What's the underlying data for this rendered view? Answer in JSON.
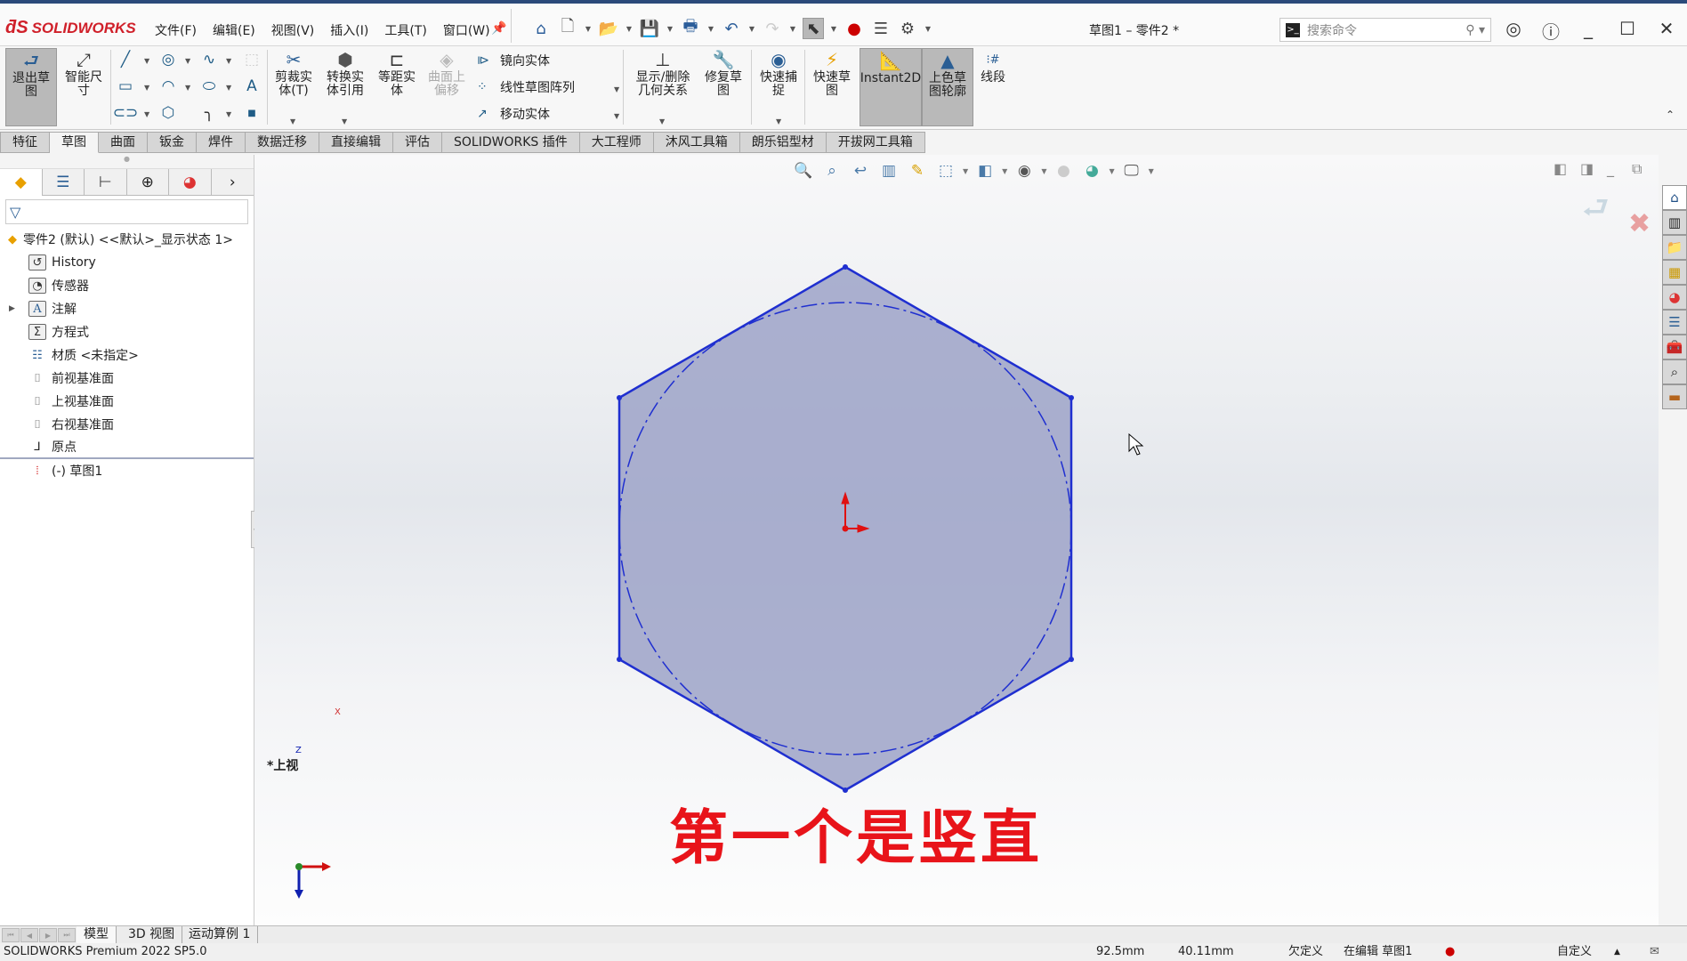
{
  "app": {
    "brand": "SOLIDWORKS",
    "document_title": "草图1 – 零件2 *",
    "menus": [
      "文件(F)",
      "编辑(E)",
      "视图(V)",
      "插入(I)",
      "工具(T)",
      "窗口(W)"
    ],
    "search_placeholder": "搜索命令",
    "quick_access_icons": [
      "home-icon",
      "new-document-icon",
      "open-icon",
      "save-icon",
      "print-icon",
      "undo-icon",
      "redo-icon",
      "select-cursor-icon",
      "rebuild-traffic-light-icon",
      "file-properties-icon",
      "options-gear-icon"
    ]
  },
  "ribbon": {
    "exit_sketch": "退出草图",
    "smart_dimension": "智能尺寸",
    "trim_entities": "剪裁实体(T)",
    "convert_entities": "转换实体引用",
    "offset_entities": "等距实体",
    "offset_on_surface": "曲面上偏移",
    "mirror_entities": "镜向实体",
    "linear_pattern": "线性草图阵列",
    "move_entities": "移动实体",
    "display_relations": "显示/删除几何关系",
    "repair_sketch": "修复草图",
    "quick_snaps": "快速捕捉",
    "rapid_sketch": "快速草图",
    "instant2d": "Instant2D",
    "shaded_contours": "上色草图轮廓",
    "segment": "线段"
  },
  "command_tabs": [
    {
      "label": "特征",
      "active": false
    },
    {
      "label": "草图",
      "active": true
    },
    {
      "label": "曲面",
      "active": false
    },
    {
      "label": "钣金",
      "active": false
    },
    {
      "label": "焊件",
      "active": false
    },
    {
      "label": "数据迁移",
      "active": false
    },
    {
      "label": "直接编辑",
      "active": false
    },
    {
      "label": "评估",
      "active": false
    },
    {
      "label": "SOLIDWORKS 插件",
      "active": false
    },
    {
      "label": "大工程师",
      "active": false
    },
    {
      "label": "沐风工具箱",
      "active": false
    },
    {
      "label": "朗乐铝型材",
      "active": false
    },
    {
      "label": "开拔网工具箱",
      "active": false
    }
  ],
  "feature_tree": {
    "root": "零件2 (默认) <<默认>_显示状态 1>",
    "items": [
      {
        "label": "History",
        "icon": "history-folder-icon"
      },
      {
        "label": "传感器",
        "icon": "sensors-folder-icon"
      },
      {
        "label": "注解",
        "icon": "annotations-folder-icon",
        "expandable": true
      },
      {
        "label": "方程式",
        "icon": "equations-folder-icon"
      },
      {
        "label": "材质 <未指定>",
        "icon": "material-icon"
      },
      {
        "label": "前视基准面",
        "icon": "plane-icon"
      },
      {
        "label": "上视基准面",
        "icon": "plane-icon"
      },
      {
        "label": "右视基准面",
        "icon": "plane-icon"
      },
      {
        "label": "原点",
        "icon": "origin-icon"
      },
      {
        "label": "(-) 草图1",
        "icon": "sketch-icon"
      }
    ]
  },
  "viewport": {
    "caption": "第一个是竖直",
    "view_label": "*上视",
    "axis_x": "X",
    "axis_z": "Z",
    "sketch_color": "#1f2fd0",
    "fill_color": "#9ea3c8"
  },
  "bottom_tabs": [
    "模型",
    "3D 视图",
    "运动算例 1"
  ],
  "status": {
    "product": "SOLIDWORKS Premium 2022 SP5.0",
    "x": "92.5mm",
    "y": "40.11mm",
    "definition": "欠定义",
    "editing": "在编辑 草图1",
    "units": "自定义"
  }
}
